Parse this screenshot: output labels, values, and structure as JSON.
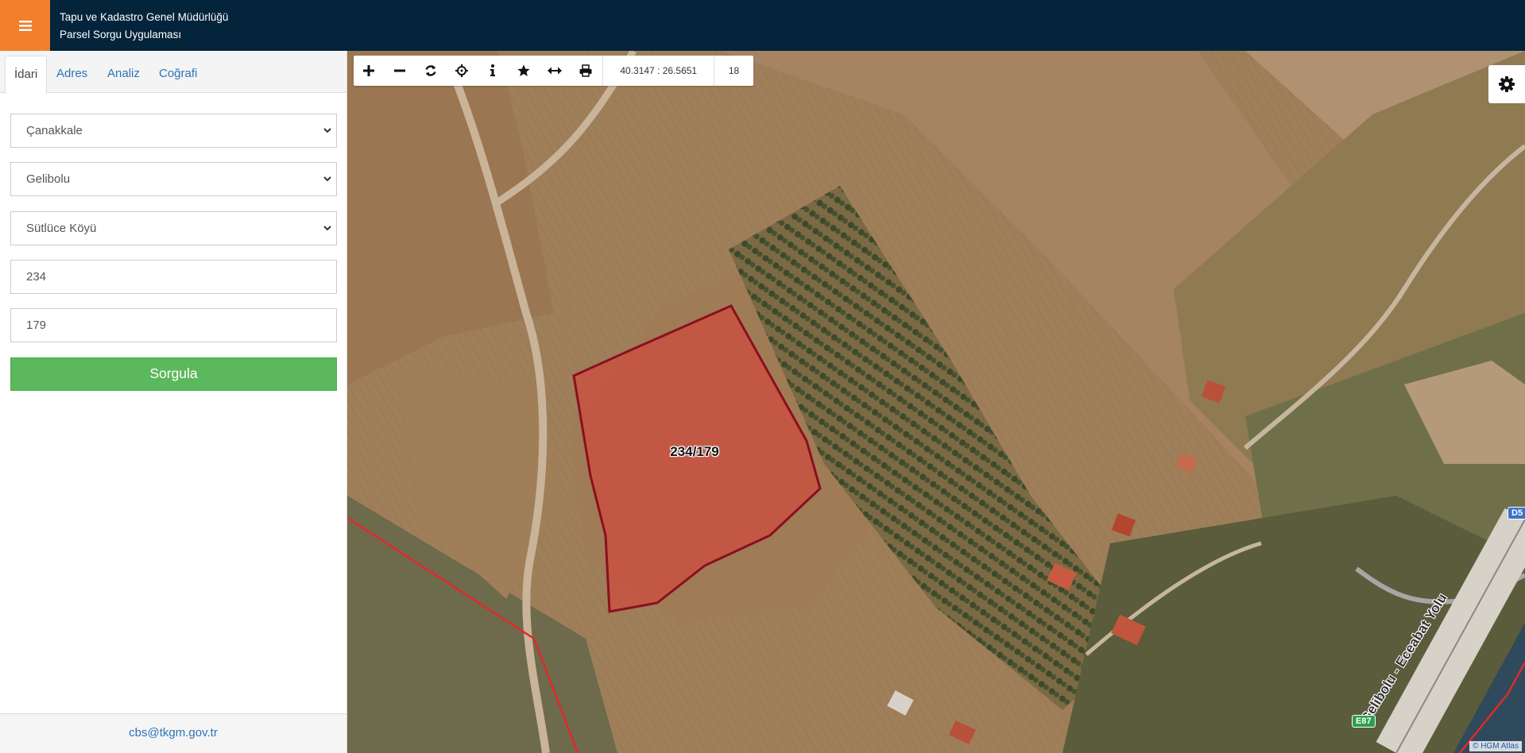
{
  "header": {
    "org_name": "Tapu ve Kadastro Genel Müdürlüğü",
    "app_name": "Parsel Sorgu Uygulaması",
    "menu_icon": "hamburger-icon",
    "colors": {
      "header_bg": "#03243a",
      "menu_bg": "#f17f2b"
    }
  },
  "sidebar": {
    "tabs": [
      {
        "label": "İdari",
        "active": true
      },
      {
        "label": "Adres",
        "active": false
      },
      {
        "label": "Analiz",
        "active": false
      },
      {
        "label": "Coğrafi",
        "active": false
      }
    ],
    "form": {
      "province": "Çanakkale",
      "district": "Gelibolu",
      "neighborhood": "Sütlüce Köyü",
      "block": "234",
      "parcel": "179",
      "submit_label": "Sorgula"
    },
    "footer_email": "cbs@tkgm.gov.tr",
    "colors": {
      "submit": "#5cb85c",
      "link": "#2e73b8"
    }
  },
  "map": {
    "toolbar": {
      "tools": [
        "zoom-in-icon",
        "zoom-out-icon",
        "refresh-icon",
        "locate-icon",
        "info-icon",
        "favorite-star-icon",
        "measure-icon",
        "print-icon"
      ],
      "coordinates": "40.3147 : 26.5651",
      "zoom_level": "18"
    },
    "settings_icon": "gear-icon",
    "parcel_label": "234/179",
    "road_label": "Gelibolu - Eceabat Yolu",
    "road_shields": {
      "e_road": "E87",
      "d_road": "D5"
    },
    "attribution": "© HGM Atlas",
    "colors": {
      "parcel_fill": "#c9503f",
      "parcel_stroke": "#8a0f1f",
      "boundary": "#e02a2a"
    }
  }
}
